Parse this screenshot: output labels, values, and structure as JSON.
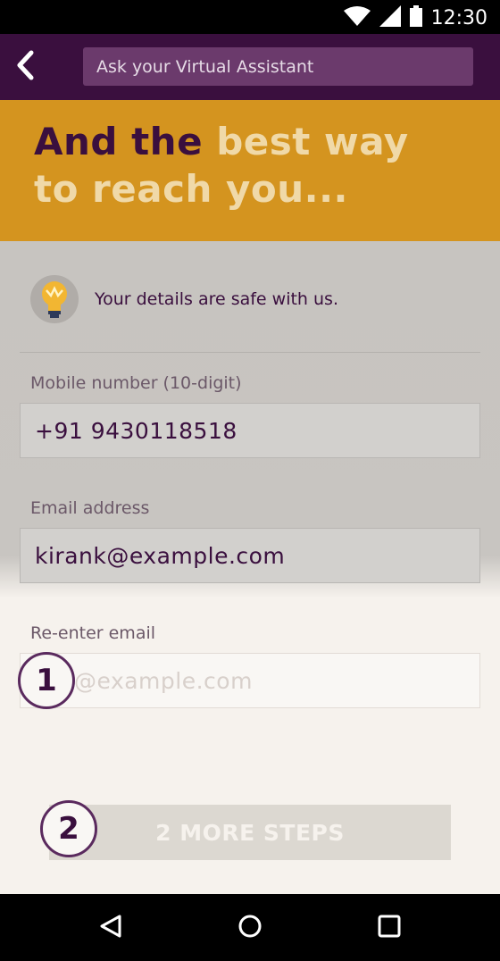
{
  "status_bar": {
    "time": "12:30",
    "icons": [
      "wifi-icon",
      "cell-signal-icon",
      "battery-icon"
    ]
  },
  "toolbar": {
    "back_icon": "chevron-left-icon",
    "search_placeholder": "Ask your Virtual Assistant"
  },
  "hero": {
    "title_part1": "And the ",
    "title_part2": "best way to reach you..."
  },
  "safety": {
    "icon": "lightbulb-icon",
    "text": "Your details are safe with us."
  },
  "form": {
    "mobile_label": "Mobile number (10-digit)",
    "mobile_value": "+91 9430118518",
    "email_label": "Email address",
    "email_value": "kirank@example.com",
    "reenter_label": "Re-enter email",
    "reenter_placeholder": "@example.com"
  },
  "badges": {
    "first": "1",
    "second": "2"
  },
  "cta": {
    "label": "2 MORE STEPS"
  },
  "nav_bar": {
    "icons": [
      "back-triangle-icon",
      "home-circle-icon",
      "recents-square-icon"
    ]
  },
  "colors": {
    "brand_purple": "#3a0f3e",
    "brand_gold": "#d4941f",
    "gold_light_text": "#f0d9a8"
  }
}
